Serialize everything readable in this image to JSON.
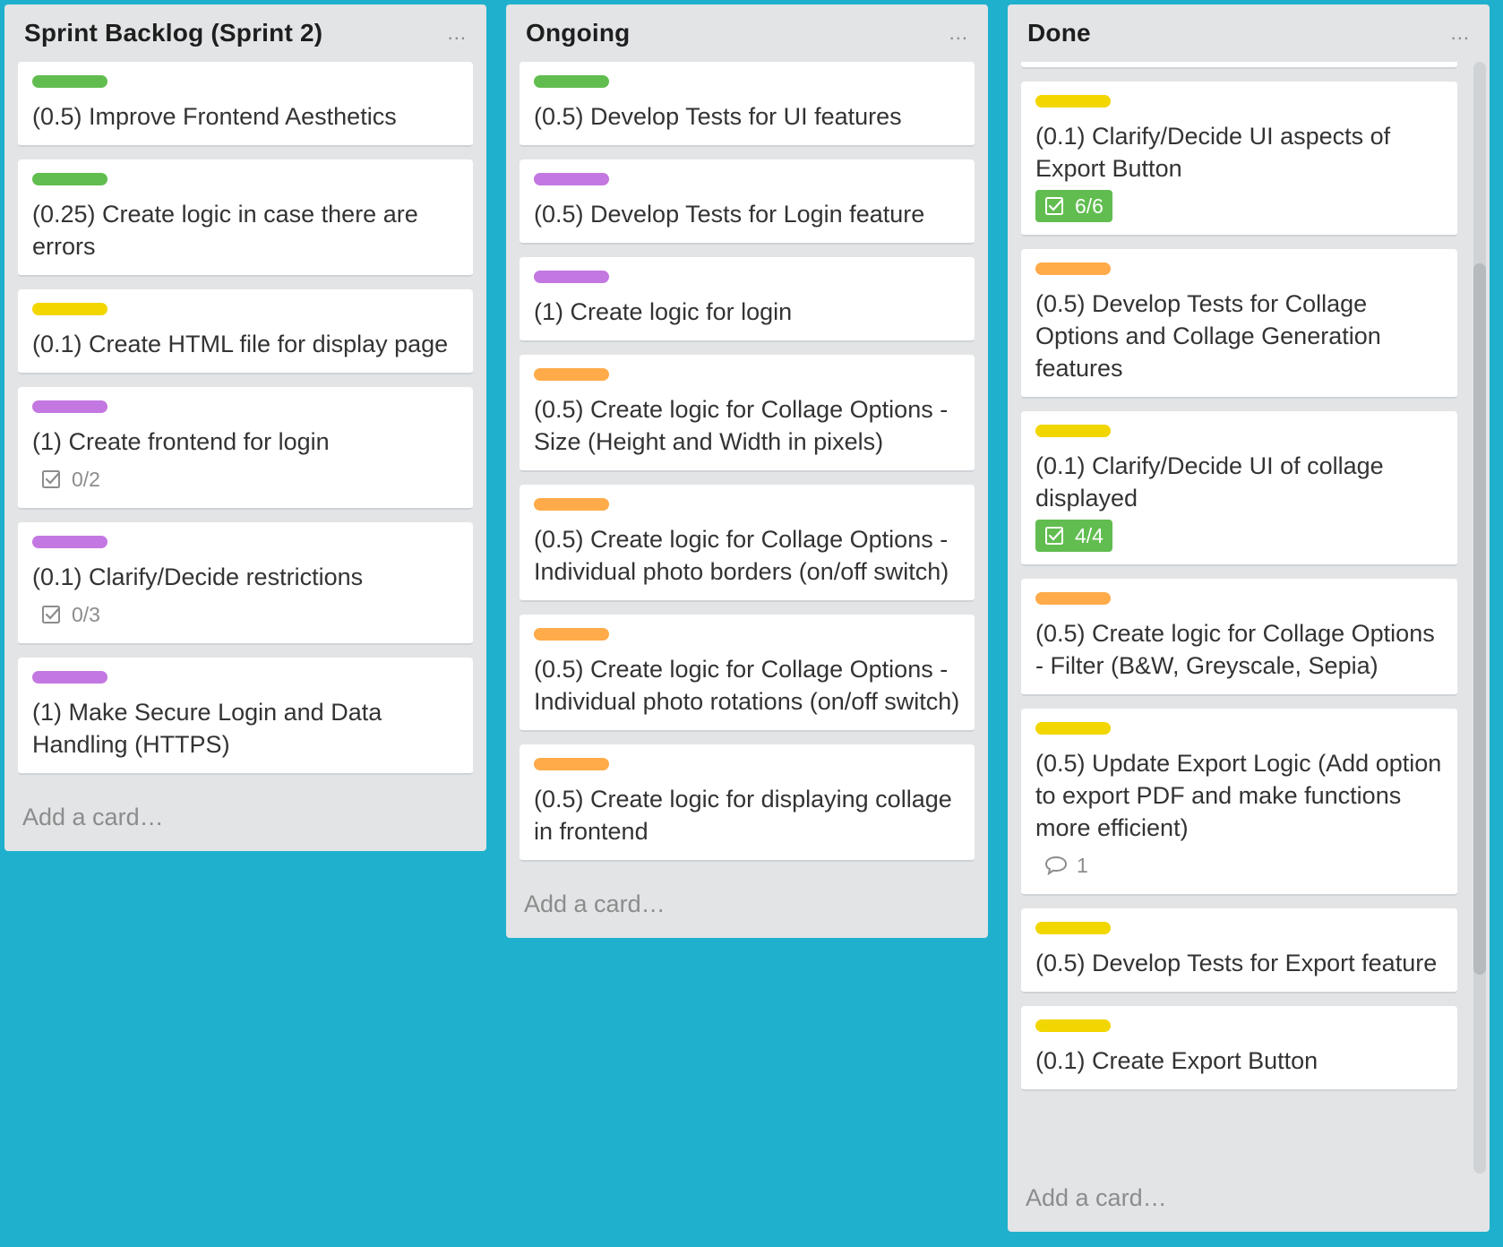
{
  "colors": {
    "board_bg": "#1fb0cd",
    "label_green": "#61bd4f",
    "label_yellow": "#f2d600",
    "label_orange": "#ffab4a",
    "label_purple": "#c377e0"
  },
  "list_menu_icon": "ellipsis-icon",
  "lists": [
    {
      "title": "Sprint Backlog (Sprint 2)",
      "menu": "...",
      "add_card": "Add a card…",
      "cards": [
        {
          "label": "green",
          "title": "(0.5) Improve Frontend Aesthetics"
        },
        {
          "label": "green",
          "title": "(0.25) Create logic in case there are errors"
        },
        {
          "label": "yellow",
          "title": "(0.1) Create HTML file for display page"
        },
        {
          "label": "purple",
          "title": "(1) Create frontend for login",
          "checklist": "0/2"
        },
        {
          "label": "purple",
          "title": "(0.1) Clarify/Decide restrictions",
          "checklist": "0/3"
        },
        {
          "label": "purple",
          "title": "(1) Make Secure Login and Data Handling (HTTPS)"
        }
      ]
    },
    {
      "title": "Ongoing",
      "menu": "...",
      "add_card": "Add a card…",
      "cards": [
        {
          "label": "green",
          "title": "(0.5) Develop Tests for UI features"
        },
        {
          "label": "purple",
          "title": "(0.5) Develop Tests for Login feature"
        },
        {
          "label": "purple",
          "title": "(1) Create logic for login"
        },
        {
          "label": "orange",
          "title": "(0.5) Create logic for Collage Options - Size (Height and Width in pixels)"
        },
        {
          "label": "orange",
          "title": "(0.5) Create logic for Collage Options - Individual photo borders (on/off switch)"
        },
        {
          "label": "orange",
          "title": "(0.5) Create logic for Collage Options - Individual photo rotations (on/off switch)"
        },
        {
          "label": "orange",
          "title": "(0.5) Create logic for displaying collage in frontend"
        }
      ]
    },
    {
      "title": "Done",
      "menu": "...",
      "add_card": "Add a card…",
      "cards": [
        {
          "label": "yellow",
          "title": "(0.1) Clarify/Decide UI aspects of Export Button",
          "checklist": "6/6",
          "complete": true
        },
        {
          "label": "orange",
          "title": "(0.5) Develop Tests for Collage Options and Collage Generation features"
        },
        {
          "label": "yellow",
          "title": "(0.1) Clarify/Decide UI of collage displayed",
          "checklist": "4/4",
          "complete": true
        },
        {
          "label": "orange",
          "title": "(0.5) Create logic for Collage Options - Filter (B&W, Greyscale, Sepia)"
        },
        {
          "label": "yellow",
          "title": "(0.5) Update Export Logic (Add option to export PDF and make functions more efficient)",
          "comments": "1"
        },
        {
          "label": "yellow",
          "title": "(0.5) Develop Tests for Export feature"
        },
        {
          "label": "yellow",
          "title": "(0.1) Create Export Button"
        }
      ],
      "scroll_position": 0.42
    }
  ]
}
